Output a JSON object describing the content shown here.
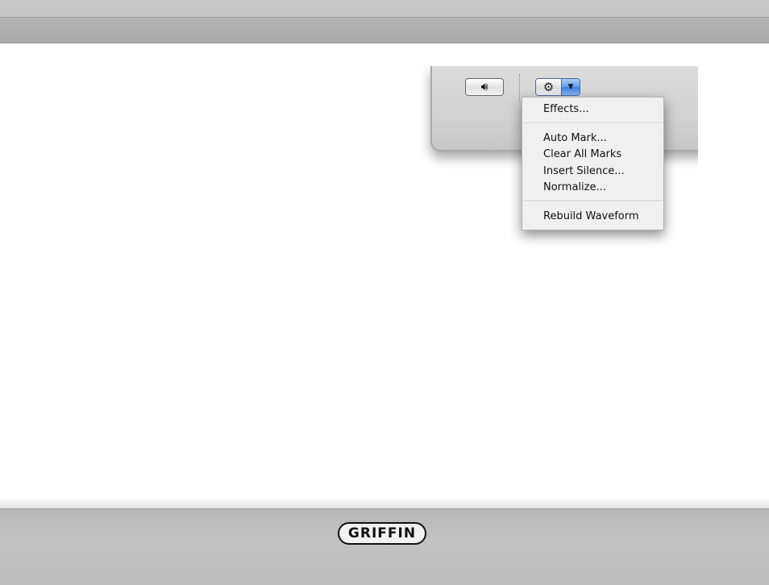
{
  "toolbar": {
    "volume_icon": "speaker-icon",
    "gear_icon": "gear-icon",
    "dropdown_icon": "triangle-down-icon",
    "action_accent_color": "#3d82e0"
  },
  "menu": {
    "items": [
      {
        "label": "Effects..."
      },
      {
        "label": "Auto Mark..."
      },
      {
        "label": "Clear All Marks"
      },
      {
        "label": "Insert Silence..."
      },
      {
        "label": "Normalize..."
      },
      {
        "label": "Rebuild Waveform"
      }
    ]
  },
  "footer": {
    "logo_text": "GRIFFIN"
  }
}
